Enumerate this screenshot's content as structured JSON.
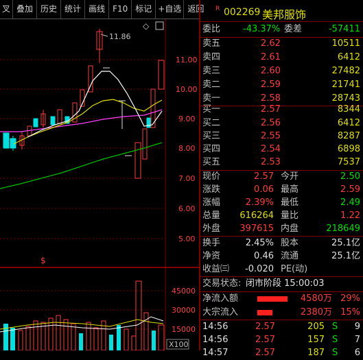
{
  "toolbar": {
    "items": [
      "叉",
      "叠加",
      "历史",
      "统计",
      "画线",
      "F10",
      "标记",
      "+自选",
      "返回"
    ]
  },
  "chart": {
    "price_axis": [
      "11.00",
      "10.00",
      "9.00",
      "8.00",
      "7.00",
      "6.00",
      "5.00"
    ],
    "volume_axis": [
      "45000",
      "30000",
      "15000"
    ],
    "volume_unit": "X100",
    "high_marker": "11.86",
    "s_marker": "$"
  },
  "stock": {
    "flag": "R",
    "code": "002269",
    "name": "美邦服饰"
  },
  "weibi": {
    "label1": "委比",
    "value1": "-43.37%",
    "label2": "委差",
    "value2": "-57411"
  },
  "asks": [
    {
      "label": "卖五",
      "price": "2.62",
      "vol": "10511"
    },
    {
      "label": "卖四",
      "price": "2.61",
      "vol": "6412"
    },
    {
      "label": "卖三",
      "price": "2.60",
      "vol": "27482"
    },
    {
      "label": "卖二",
      "price": "2.59",
      "vol": "21741"
    },
    {
      "label": "卖一",
      "price": "2.58",
      "vol": "28743"
    }
  ],
  "bids": [
    {
      "label": "买一",
      "price": "2.57",
      "vol": "8344"
    },
    {
      "label": "买二",
      "price": "2.56",
      "vol": "6412"
    },
    {
      "label": "买三",
      "price": "2.55",
      "vol": "8287"
    },
    {
      "label": "买四",
      "price": "2.54",
      "vol": "6898"
    },
    {
      "label": "买五",
      "price": "2.53",
      "vol": "7537"
    }
  ],
  "quote": [
    {
      "l1": "现价",
      "v1": "2.57",
      "l2": "今开",
      "v2": "2.50",
      "c1": "red",
      "c2": "green"
    },
    {
      "l1": "涨跌",
      "v1": "0.06",
      "l2": "最高",
      "v2": "2.59",
      "c1": "red",
      "c2": "red"
    },
    {
      "l1": "涨幅",
      "v1": "2.39%",
      "l2": "最低",
      "v2": "2.49",
      "c1": "red",
      "c2": "green"
    },
    {
      "l1": "总量",
      "v1": "616264",
      "l2": "量比",
      "v2": "1.22",
      "c1": "white",
      "c2": "red"
    },
    {
      "l1": "外盘",
      "v1": "397615",
      "l2": "内盘",
      "v2": "218649",
      "c1": "red",
      "c2": "green"
    }
  ],
  "fund": [
    {
      "l1": "换手",
      "v1": "2.45%",
      "l2": "股本",
      "v2": "25.1亿"
    },
    {
      "l1": "净资",
      "v1": "0.46",
      "l2": "流通",
      "v2": "25.1亿"
    },
    {
      "l1": "收益㈢",
      "v1": "-0.020",
      "l2": "PE(动)",
      "v2": ""
    }
  ],
  "trade_status": {
    "label": "交易状态:",
    "value": "闭市阶段 15:00:03"
  },
  "flows": [
    {
      "label": "净流入额",
      "amount": "4580万",
      "pct": "29%"
    },
    {
      "label": "大宗流入",
      "amount": "2380万",
      "pct": "15%"
    }
  ],
  "ticks": [
    {
      "time": "14:56",
      "price": "2.57",
      "vol": "205",
      "side": "S",
      "count": "9"
    },
    {
      "time": "14:56",
      "price": "2.57",
      "vol": "157",
      "side": "S",
      "count": "7"
    },
    {
      "time": "14:57",
      "price": "2.57",
      "vol": "187",
      "side": "S",
      "count": "6"
    }
  ],
  "colors": {
    "up": "#ff3c3c",
    "down": "#00e0e0",
    "ma5": "#ffffff",
    "ma10": "#e0e000",
    "ma20": "#ff40ff",
    "ma60": "#00c000"
  }
}
